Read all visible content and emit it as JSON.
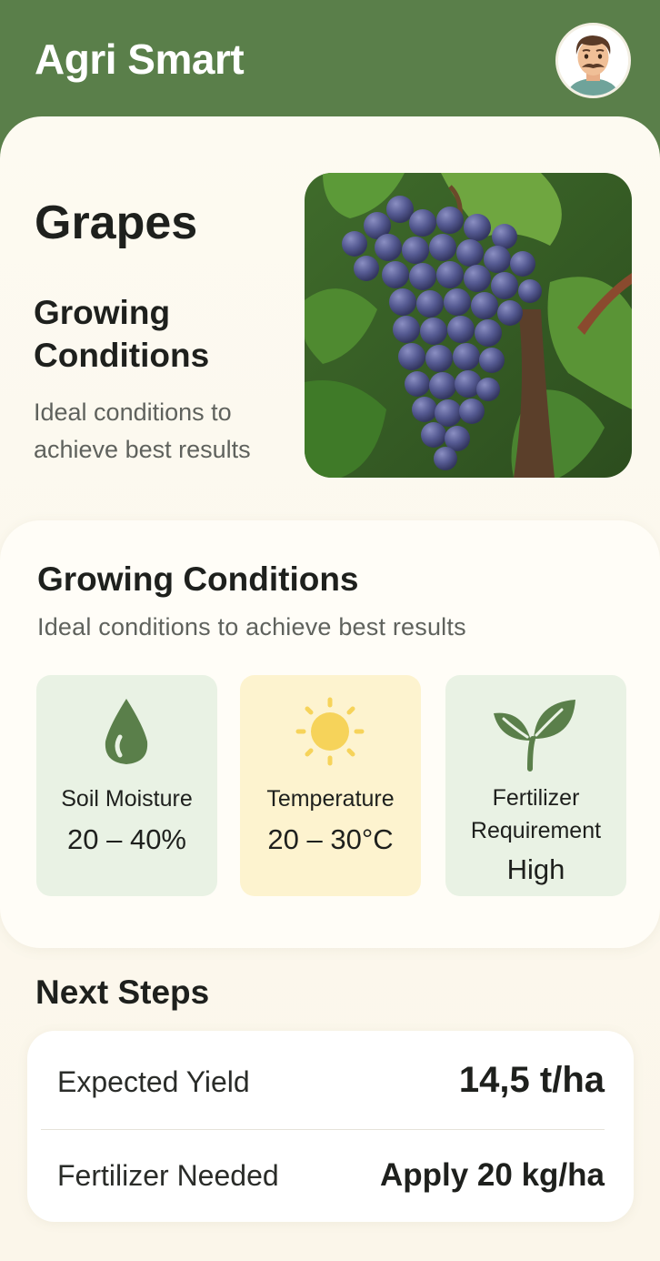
{
  "app": {
    "title": "Agri Smart",
    "colors": {
      "header": "#5a7f4a",
      "accent_green": "#5a7f4a",
      "sun": "#f5cf4a"
    }
  },
  "header": {
    "avatar_icon": "user-avatar"
  },
  "hero": {
    "title": "Grapes",
    "subtitle": "Growing Conditions",
    "description": "Ideal conditions to achieve best results",
    "image_icon": "grapes-photo"
  },
  "conditions": {
    "title": "Growing Conditions",
    "description": "Ideal conditions to achieve best results",
    "metrics": [
      {
        "icon": "water-drop-icon",
        "label": "Soil Moisture",
        "value": "20 – 40%"
      },
      {
        "icon": "sun-icon",
        "label": "Temperature",
        "value": "20 – 30°C"
      },
      {
        "icon": "leaf-icon",
        "label": "Fertilizer Requirement",
        "value": "High"
      }
    ]
  },
  "next_steps": {
    "title": "Next Steps",
    "rows": [
      {
        "label": "Expected Yield",
        "value": "14,5 t/ha"
      },
      {
        "label": "Fertilizer Needed",
        "value": "Apply 20 kg/ha"
      }
    ]
  }
}
